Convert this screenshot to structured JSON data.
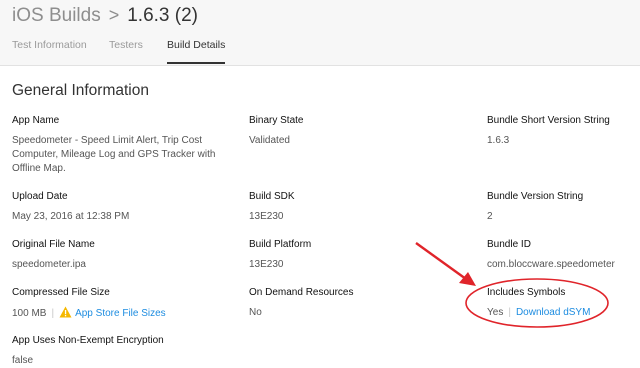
{
  "header": {
    "breadcrumb_root": "iOS Builds",
    "breadcrumb_separator": ">",
    "breadcrumb_current": "1.6.3 (2)",
    "tabs": [
      {
        "label": "Test Information",
        "active": false
      },
      {
        "label": "Testers",
        "active": false
      },
      {
        "label": "Build Details",
        "active": true
      }
    ]
  },
  "section_title": "General Information",
  "fields": {
    "app_name": {
      "label": "App Name",
      "value": "Speedometer - Speed Limit Alert, Trip Cost Computer, Mileage Log and GPS Tracker with Offline Map."
    },
    "binary_state": {
      "label": "Binary State",
      "value": "Validated"
    },
    "bundle_short_version": {
      "label": "Bundle Short Version String",
      "value": "1.6.3"
    },
    "upload_date": {
      "label": "Upload Date",
      "value": "May 23, 2016 at 12:38 PM"
    },
    "build_sdk": {
      "label": "Build SDK",
      "value": "13E230"
    },
    "bundle_version": {
      "label": "Bundle Version String",
      "value": "2"
    },
    "original_file_name": {
      "label": "Original File Name",
      "value": "speedometer.ipa"
    },
    "build_platform": {
      "label": "Build Platform",
      "value": "13E230"
    },
    "bundle_id": {
      "label": "Bundle ID",
      "value": "com.bloccware.speedometer"
    },
    "compressed_file_size": {
      "label": "Compressed File Size",
      "value": "100 MB",
      "link": "App Store File Sizes"
    },
    "on_demand_resources": {
      "label": "On Demand Resources",
      "value": "No"
    },
    "includes_symbols": {
      "label": "Includes Symbols",
      "value": "Yes",
      "link": "Download dSYM"
    },
    "non_exempt_encryption": {
      "label": "App Uses Non-Exempt Encryption",
      "value": "false"
    }
  },
  "colors": {
    "link": "#1d8ce0",
    "annotation": "#e0242a",
    "warning": "#f5b800",
    "header_bg": "#f7f7f7"
  }
}
